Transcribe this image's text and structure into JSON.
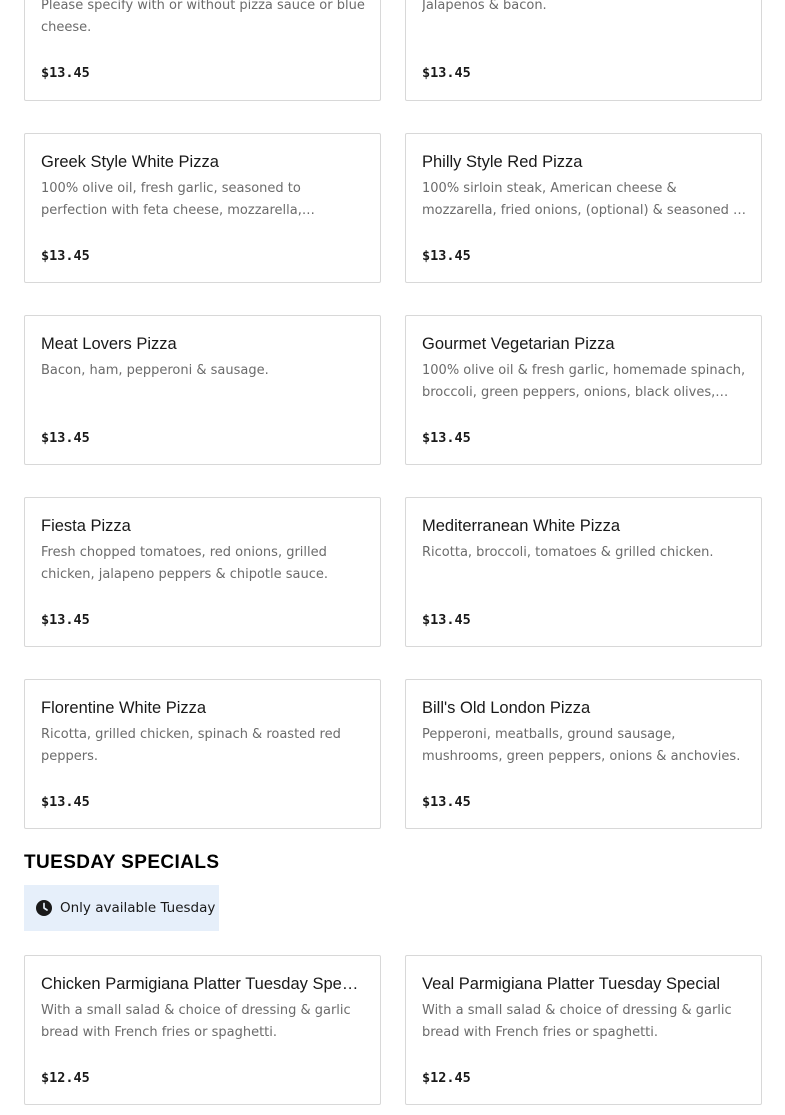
{
  "menu_items": [
    {
      "name": "",
      "description": "Please specify with or without pizza sauce or blue cheese.",
      "price": "$13.45"
    },
    {
      "name": "",
      "description": "Jalapenos & bacon.",
      "price": "$13.45"
    },
    {
      "name": "Greek Style White Pizza",
      "description": "100% olive oil, fresh garlic, seasoned to perfection with feta cheese, mozzarella, homemade spinach.",
      "price": "$13.45"
    },
    {
      "name": "Philly Style Red Pizza",
      "description": "100% sirloin steak, American cheese & mozzarella, fried onions, (optional) & seasoned to perfection.",
      "price": "$13.45"
    },
    {
      "name": "Meat Lovers Pizza",
      "description": "Bacon, ham, pepperoni & sausage.",
      "price": "$13.45"
    },
    {
      "name": "Gourmet Vegetarian Pizza",
      "description": "100% olive oil & fresh garlic, homemade spinach, broccoli, green peppers, onions, black olives, mushrooms.",
      "price": "$13.45"
    },
    {
      "name": "Fiesta Pizza",
      "description": "Fresh chopped tomatoes, red onions, grilled chicken, jalapeno peppers & chipotle sauce.",
      "price": "$13.45"
    },
    {
      "name": "Mediterranean White Pizza",
      "description": "Ricotta, broccoli, tomatoes & grilled chicken.",
      "price": "$13.45"
    },
    {
      "name": "Florentine White Pizza",
      "description": "Ricotta, grilled chicken, spinach & roasted red peppers.",
      "price": "$13.45"
    },
    {
      "name": "Bill's Old London Pizza",
      "description": "Pepperoni, meatballs, ground sausage, mushrooms, green peppers, onions & anchovies.",
      "price": "$13.45"
    }
  ],
  "tuesday_specials": {
    "title": "TUESDAY SPECIALS",
    "availability": {
      "icon": "clock-icon",
      "text": "Only available Tuesday",
      "background": "#e6effa"
    },
    "items": [
      {
        "name": "Chicken Parmigiana Platter Tuesday Special",
        "description": "With a small salad & choice of dressing & garlic bread with French fries or spaghetti.",
        "price": "$12.45"
      },
      {
        "name": "Veal Parmigiana Platter Tuesday Special",
        "description": "With a small salad & choice of dressing & garlic bread with French fries or spaghetti.",
        "price": "$12.45"
      }
    ]
  }
}
